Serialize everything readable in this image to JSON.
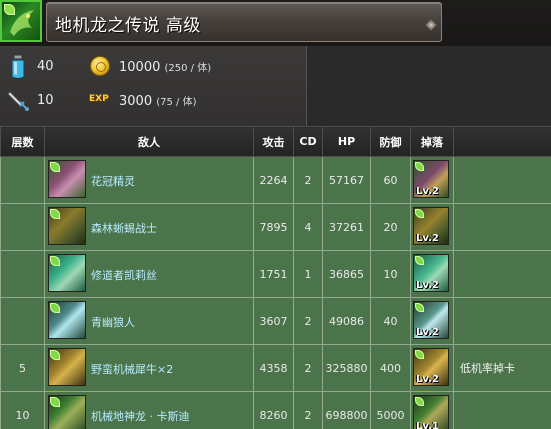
{
  "header": {
    "title": "地机龙之传说 高级",
    "icon": "dragon-attribute-icon"
  },
  "stats": {
    "stamina_icon": "stamina-potion-icon",
    "stamina": "40",
    "coin_icon": "gold-coin-icon",
    "coin": "10000",
    "coin_note": "(250 / 体)",
    "rounds_icon": "sword-icon",
    "rounds": "10",
    "exp_badge": "EXP",
    "exp": "3000",
    "exp_note": "(75 / 体)"
  },
  "table": {
    "columns": [
      "层数",
      "敌人",
      "攻击",
      "CD",
      "HP",
      "防御",
      "掉落",
      ""
    ],
    "rows": [
      {
        "floor": "",
        "enemy": "花冠精灵",
        "attack": "2264",
        "cd": "2",
        "hp": "57167",
        "defense": "60",
        "drop_level": "Lv.2",
        "note": ""
      },
      {
        "floor": "",
        "enemy": "森林蜥蜴战士",
        "attack": "7895",
        "cd": "4",
        "hp": "37261",
        "defense": "20",
        "drop_level": "Lv.2",
        "note": ""
      },
      {
        "floor": "",
        "enemy": "修道者凯莉丝",
        "attack": "1751",
        "cd": "1",
        "hp": "36865",
        "defense": "10",
        "drop_level": "Lv.2",
        "note": ""
      },
      {
        "floor": "",
        "enemy": "青幽狼人",
        "attack": "3607",
        "cd": "2",
        "hp": "49086",
        "defense": "40",
        "drop_level": "Lv.2",
        "note": ""
      },
      {
        "floor": "5",
        "enemy": "野蛮机械犀牛×2",
        "attack": "4358",
        "cd": "2",
        "hp": "325880",
        "defense": "400",
        "drop_level": "Lv.2",
        "note": "低机率掉卡"
      },
      {
        "floor": "10",
        "enemy": "机械地神龙 · 卡斯迪",
        "attack": "8260",
        "cd": "2",
        "hp": "698800",
        "defense": "5000",
        "drop_level": "Lv.1",
        "note": ""
      }
    ]
  },
  "colors": {
    "row_bg": "#4c744b",
    "enemy_name": "#b8ecff",
    "header_bg": "#2a2a2a"
  }
}
